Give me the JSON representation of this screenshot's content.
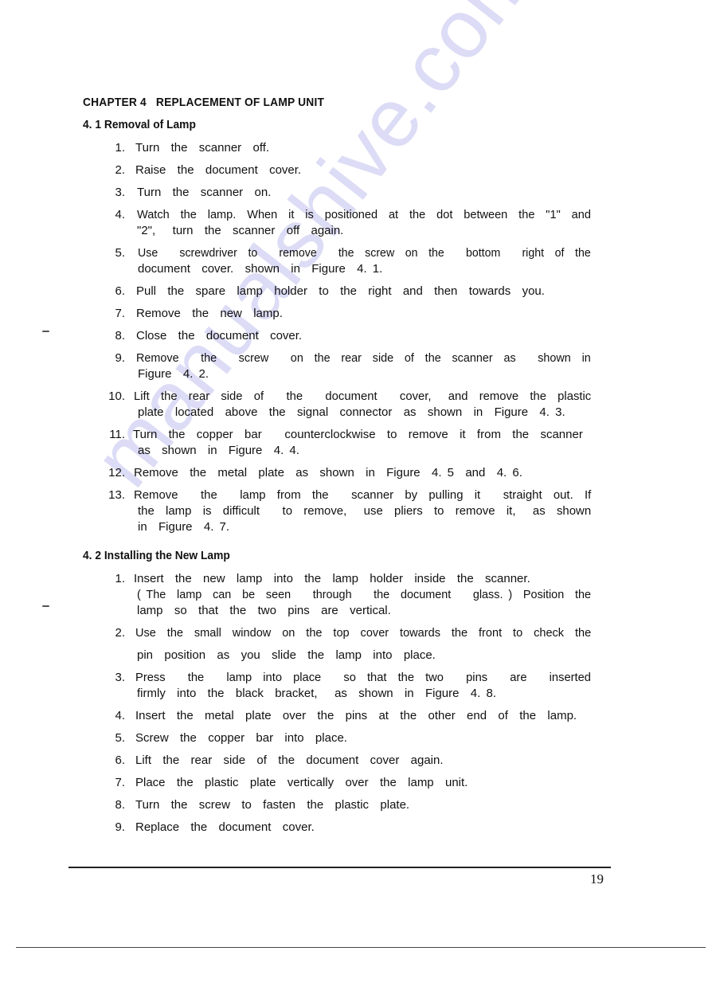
{
  "watermark": "manualshive.com",
  "chapter_title": "CHAPTER 4   REPLACEMENT OF LAMP UNIT",
  "sections": [
    {
      "title": "4. 1 Removal of Lamp",
      "items": [
        {
          "num": "1.",
          "lines": [
            "Turn  the  scanner  off."
          ]
        },
        {
          "num": "2.",
          "lines": [
            "Raise  the  document  cover."
          ]
        },
        {
          "num": "3.",
          "lines": [
            "Turn  the  scanner  on."
          ]
        },
        {
          "num": "4.",
          "lines": [
            "Watch  the  lamp.  When  it  is  positioned  at  the  dot  between  the  \"1\"  and",
            "\"2\",   turn  the  scanner  off  again."
          ]
        },
        {
          "num": "5.",
          "lines": [
            "Use    screwdriver  to    remove    the  screw  on  the    bottom    right  of  the",
            "document  cover.  shown  in  Figure  4. 1."
          ]
        },
        {
          "num": "6.",
          "lines": [
            "Pull  the  spare  lamp  holder  to  the  right  and  then  towards  you."
          ]
        },
        {
          "num": "7.",
          "lines": [
            "Remove  the  new  lamp."
          ]
        },
        {
          "num": "8.",
          "lines": [
            "Close  the  document  cover."
          ]
        },
        {
          "num": "9.",
          "lines": [
            "Remove    the    screw    on  the  rear  side  of  the  scanner  as    shown  in",
            "Figure  4. 2."
          ]
        },
        {
          "num": "10.",
          "lines": [
            "Lift  the  rear  side  of    the    document    cover,   and  remove  the  plastic",
            "plate  located  above  the  signal  connector  as  shown  in  Figure  4. 3."
          ]
        },
        {
          "num": "11.",
          "lines": [
            "Turn  the  copper  bar    counterclockwise  to  remove  it  from  the  scanner",
            "as  shown  in  Figure  4. 4."
          ]
        },
        {
          "num": "12.",
          "lines": [
            "Remove  the  metal  plate  as  shown  in  Figure  4. 5  and  4. 6."
          ]
        },
        {
          "num": "13.",
          "lines": [
            "Remove    the    lamp  from  the    scanner  by  pulling  it    straight  out.  If",
            "the  lamp  is  difficult    to  remove,   use  pliers  to  remove  it,   as  shown",
            "in  Figure  4. 7."
          ]
        }
      ]
    },
    {
      "title": "4. 2 Installing the New Lamp",
      "items": [
        {
          "num": "1.",
          "lines": [
            "Insert  the  new  lamp  into  the  lamp  holder  inside  the  scanner.",
            "( The  lamp  can  be  seen    through    the  document    glass. )  Position  the",
            "lamp  so  that  the  two  pins  are  vertical."
          ]
        },
        {
          "num": "2.",
          "lines": [
            "Use  the  small  window  on  the  top  cover  towards  the  front  to  check  the",
            "pin  position  as  you  slide  the  lamp  into  place."
          ]
        },
        {
          "num": "3.",
          "lines": [
            "Press    the    lamp  into  place    so  that  the  two    pins    are    inserted",
            "firmly  into  the  black  bracket,   as  shown  in  Figure  4. 8."
          ]
        },
        {
          "num": "4.",
          "lines": [
            "Insert  the  metal  plate  over  the  pins  at  the  other  end  of  the  lamp."
          ]
        },
        {
          "num": "5.",
          "lines": [
            "Screw  the  copper  bar  into  place."
          ]
        },
        {
          "num": "6.",
          "lines": [
            "Lift  the  rear  side  of  the  document  cover  again."
          ]
        },
        {
          "num": "7.",
          "lines": [
            "Place  the  plastic  plate  vertically  over  the  lamp  unit."
          ]
        },
        {
          "num": "8.",
          "lines": [
            "Turn  the  screw  to  fasten  the  plastic  plate."
          ]
        },
        {
          "num": "9.",
          "lines": [
            "Replace  the  document  cover."
          ]
        }
      ]
    }
  ],
  "page_number": "19"
}
